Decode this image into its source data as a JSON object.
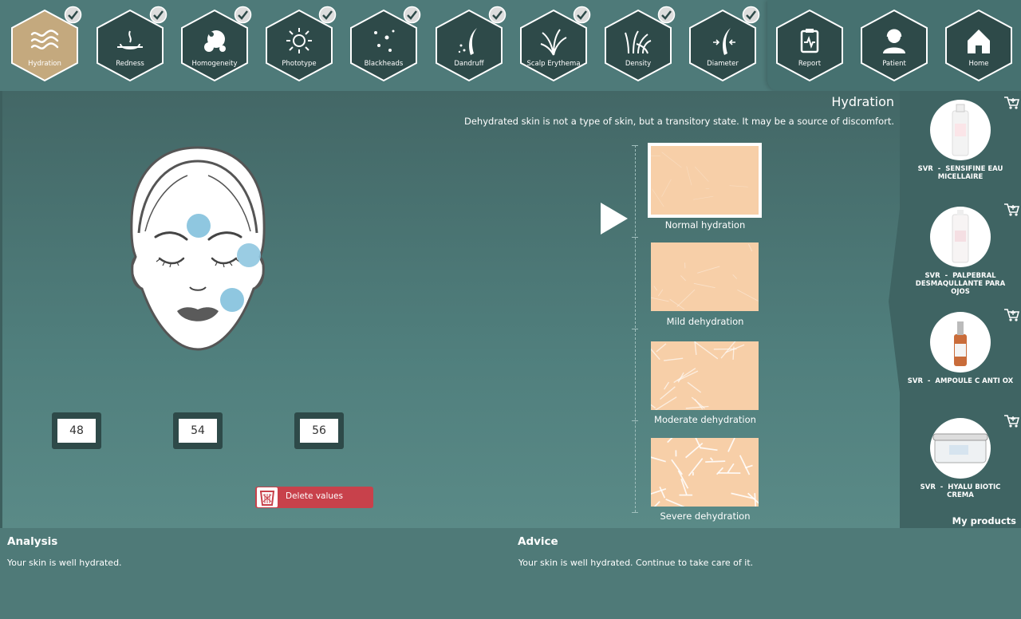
{
  "nav": {
    "items": [
      {
        "label": "Hydration",
        "icon": "waves-icon",
        "active": true,
        "checked": true
      },
      {
        "label": "Redness",
        "icon": "redness-icon",
        "active": false,
        "checked": true
      },
      {
        "label": "Homogeneity",
        "icon": "homogeneity-icon",
        "active": false,
        "checked": true
      },
      {
        "label": "Phototype",
        "icon": "sun-icon",
        "active": false,
        "checked": true
      },
      {
        "label": "Blackheads",
        "icon": "dots-icon",
        "active": false,
        "checked": true
      },
      {
        "label": "Dandruff",
        "icon": "dandruff-icon",
        "active": false,
        "checked": true
      },
      {
        "label": "Scalp Erythema",
        "icon": "scalp-icon",
        "active": false,
        "checked": true
      },
      {
        "label": "Density",
        "icon": "density-icon",
        "active": false,
        "checked": true
      },
      {
        "label": "Diameter",
        "icon": "diameter-icon",
        "active": false,
        "checked": true
      }
    ],
    "right": [
      {
        "label": "Report",
        "icon": "report-icon"
      },
      {
        "label": "Patient",
        "icon": "patient-icon"
      },
      {
        "label": "Home",
        "icon": "home-icon"
      }
    ]
  },
  "colors": {
    "active_hex": "#c4a97e",
    "dark_hex": "#2e4a49",
    "skin": "#f7cfa8",
    "delete": "#c8414b",
    "spot": "#8fc7e0"
  },
  "main": {
    "title": "Hydration",
    "subtitle": "Dehydrated skin is not a type of skin, but a transitory state. It may be a source of discomfort.",
    "values": [
      "48",
      "54",
      "56"
    ],
    "delete_label": "Delete values"
  },
  "scale": {
    "selected_index": 0,
    "levels": [
      {
        "label": "Normal hydration",
        "intensity": 0.15
      },
      {
        "label": "Mild dehydration",
        "intensity": 0.3
      },
      {
        "label": "Moderate dehydration",
        "intensity": 0.65
      },
      {
        "label": "Severe dehydration",
        "intensity": 0.95
      }
    ]
  },
  "sidebar": {
    "products": [
      {
        "brand": "SVR",
        "name": "SENSIFINE EAU MICELLAIRE"
      },
      {
        "brand": "SVR",
        "name": "PALPEBRAL DESMAQULLANTE PARA OJOS"
      },
      {
        "brand": "SVR",
        "name": "AMPOULE C ANTI OX"
      },
      {
        "brand": "SVR",
        "name": "HYALU BIOTIC CREMA"
      }
    ],
    "footer": "My products"
  },
  "bottom": {
    "analysis_title": "Analysis",
    "analysis_text": "Your skin is well hydrated.",
    "advice_title": "Advice",
    "advice_text": "Your skin is well hydrated. Continue to take care of it."
  }
}
